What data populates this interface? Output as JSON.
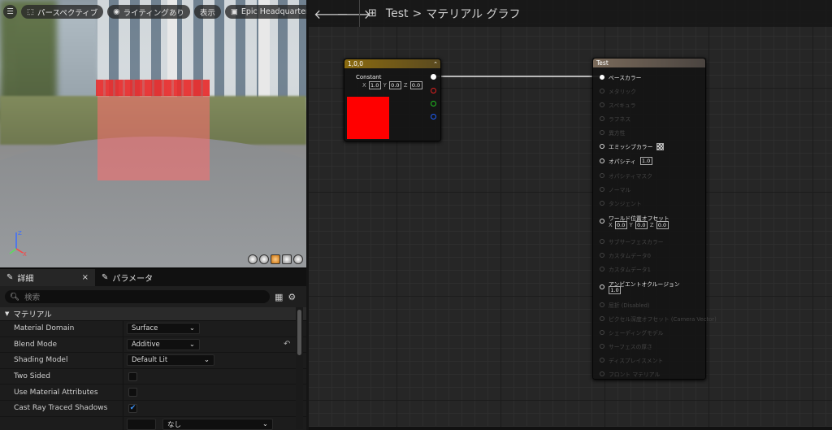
{
  "viewport": {
    "menu_icon": "hamburger-icon",
    "perspective_label": "パースペクティブ",
    "lighting_label": "ライティングあり",
    "show_label": "表示",
    "level_label": "Epic Headquarters",
    "axis_z": "Z",
    "axis_x": "X"
  },
  "details": {
    "tab_details": "詳細",
    "tab_parameters": "パラメータ",
    "search_placeholder": "検索",
    "section_material": "マテリアル",
    "props": [
      {
        "name": "Material Domain",
        "value": "Surface"
      },
      {
        "name": "Blend Mode",
        "value": "Additive"
      },
      {
        "name": "Shading Model",
        "value": "Default Lit"
      },
      {
        "name": "Two Sided",
        "checked": false
      },
      {
        "name": "Use Material Attributes",
        "checked": false
      },
      {
        "name": "Cast Ray Traced Shadows",
        "checked": true
      }
    ],
    "last_row_value": "なし"
  },
  "graph": {
    "breadcrumb_root": "Test",
    "breadcrumb_sep": ">",
    "breadcrumb_current": "マテリアル グラフ",
    "constant_node": {
      "title": "1,0,0",
      "subtitle": "Constant",
      "x_label": "X",
      "x": "1.0",
      "y_label": "Y",
      "y": "0.0",
      "z_label": "Z",
      "z": "0.0",
      "color": "#ff0000"
    },
    "result_node": {
      "title": "Test",
      "inputs": [
        {
          "label": "ベースカラー"
        },
        {
          "label": "メタリック"
        },
        {
          "label": "スペキュラ"
        },
        {
          "label": "ラフネス"
        },
        {
          "label": "異方性"
        },
        {
          "label": "エミッシブカラー"
        },
        {
          "label": "オパシティ",
          "value": "1.0"
        },
        {
          "label": "オパシティマスク"
        },
        {
          "label": "ノーマル"
        },
        {
          "label": "タンジェント"
        },
        {
          "label": "ワールド位置オフセット",
          "x": "0.0",
          "y": "0.0",
          "z": "0.0"
        },
        {
          "label": "サブサーフェスカラー"
        },
        {
          "label": "カスタムデータ0"
        },
        {
          "label": "カスタムデータ1"
        },
        {
          "label": "アンビエントオクルージョン",
          "value": "1.0"
        },
        {
          "label": "屈折 (Disabled)"
        },
        {
          "label": "ピクセル深度オフセット (Camera Vector)"
        },
        {
          "label": "シェーディングモデル"
        },
        {
          "label": "サーフェスの厚さ"
        },
        {
          "label": "ディスプレイスメント"
        },
        {
          "label": "フロント マテリアル"
        }
      ]
    }
  }
}
